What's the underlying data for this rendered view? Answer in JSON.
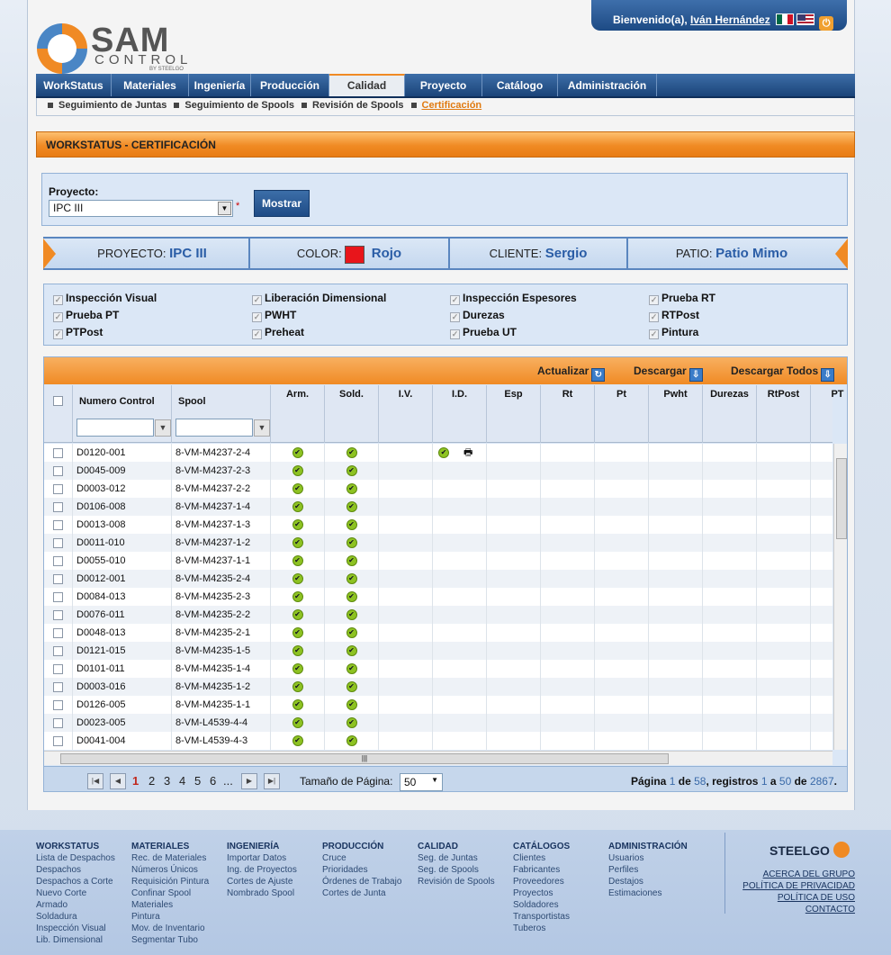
{
  "header": {
    "welcome_prefix": "Bienvenido(a),",
    "user_name": "Iván Hernández",
    "logo_main": "SAM",
    "logo_sub": "CONTROL",
    "logo_by": "BY STEELGO"
  },
  "nav": {
    "items": [
      "WorkStatus",
      "Materiales",
      "Ingeniería",
      "Producción",
      "Calidad",
      "Proyecto",
      "Catálogo",
      "Administración"
    ],
    "active": "Calidad"
  },
  "subnav": {
    "items": [
      "Seguimiento de Juntas",
      "Seguimiento de Spools",
      "Revisión de Spools",
      "Certificación"
    ],
    "current": "Certificación"
  },
  "page_title": "WORKSTATUS - CERTIFICACIÓN",
  "project_form": {
    "label": "Proyecto:",
    "selected": "IPC III",
    "required_mark": "*",
    "button": "Mostrar"
  },
  "info": {
    "proyecto_label": "PROYECTO:",
    "proyecto": "IPC III",
    "color_label": "COLOR:",
    "color_name": "Rojo",
    "color_hex": "#e8151b",
    "cliente_label": "CLIENTE:",
    "cliente": "Sergio",
    "patio_label": "PATIO:",
    "patio": "Patio Mimo"
  },
  "checkboxes": [
    [
      "Inspección Visual",
      "Liberación Dimensional",
      "Inspección Espesores",
      "Prueba RT"
    ],
    [
      "Prueba PT",
      "PWHT",
      "Durezas",
      "RTPost"
    ],
    [
      "PTPost",
      "Preheat",
      "Prueba UT",
      "Pintura"
    ]
  ],
  "grid_actions": {
    "refresh": "Actualizar",
    "download": "Descargar",
    "download_all": "Descargar Todos"
  },
  "columns": {
    "numero": "Numero Control",
    "spool": "Spool",
    "steps": [
      "Arm.",
      "Sold.",
      "I.V.",
      "I.D.",
      "Esp",
      "Rt",
      "Pt",
      "Pwht",
      "Durezas",
      "RtPost",
      "PT"
    ]
  },
  "rows": [
    [
      "D0120-001",
      "8-VM-M4237-2-4"
    ],
    [
      "D0045-009",
      "8-VM-M4237-2-3"
    ],
    [
      "D0003-012",
      "8-VM-M4237-2-2"
    ],
    [
      "D0106-008",
      "8-VM-M4237-1-4"
    ],
    [
      "D0013-008",
      "8-VM-M4237-1-3"
    ],
    [
      "D0011-010",
      "8-VM-M4237-1-2"
    ],
    [
      "D0055-010",
      "8-VM-M4237-1-1"
    ],
    [
      "D0012-001",
      "8-VM-M4235-2-4"
    ],
    [
      "D0084-013",
      "8-VM-M4235-2-3"
    ],
    [
      "D0076-011",
      "8-VM-M4235-2-2"
    ],
    [
      "D0048-013",
      "8-VM-M4235-2-1"
    ],
    [
      "D0121-015",
      "8-VM-M4235-1-5"
    ],
    [
      "D0101-011",
      "8-VM-M4235-1-4"
    ],
    [
      "D0003-016",
      "8-VM-M4235-1-2"
    ],
    [
      "D0126-005",
      "8-VM-M4235-1-1"
    ],
    [
      "D0023-005",
      "8-VM-L4539-4-4"
    ],
    [
      "D0041-004",
      "8-VM-L4539-4-3"
    ]
  ],
  "pager": {
    "pages": [
      "1",
      "2",
      "3",
      "4",
      "5",
      "6",
      "..."
    ],
    "current": "1",
    "size_label": "Tamaño de Página:",
    "size": "50",
    "summary_pagina": "Página",
    "page": "1",
    "de": "de",
    "total_pages": "58",
    "registros": ", registros",
    "from": "1",
    "a": "a",
    "to": "50",
    "de2": "de",
    "total": "2867",
    "dot": "."
  },
  "footer": {
    "cols": [
      {
        "h": "WORKSTATUS",
        "items": [
          "Lista de Despachos",
          "Despachos",
          "Despachos a Corte",
          "Nuevo Corte",
          "Armado",
          "Soldadura",
          "Inspección Visual",
          "Lib. Dimensional"
        ]
      },
      {
        "h": "MATERIALES",
        "items": [
          "Rec. de Materiales",
          "Números Únicos",
          "Requisición Pintura",
          "Confinar Spool",
          "Materiales",
          "Pintura",
          "Mov. de Inventario",
          "Segmentar Tubo"
        ]
      },
      {
        "h": "INGENIERÍA",
        "items": [
          "Importar Datos",
          "Ing. de Proyectos",
          "Cortes de Ajuste",
          "Nombrado Spool"
        ]
      },
      {
        "h": "PRODUCCIÓN",
        "items": [
          "Cruce",
          "Prioridades",
          "Órdenes de Trabajo",
          "Cortes de Junta"
        ]
      },
      {
        "h": "CALIDAD",
        "items": [
          "Seg. de Juntas",
          "Seg. de Spools",
          "Revisión de Spools"
        ]
      },
      {
        "h": "CATÁLOGOS",
        "items": [
          "Clientes",
          "Fabricantes",
          "Proveedores",
          "Proyectos",
          "Soldadores",
          "Transportistas",
          "Tuberos"
        ]
      },
      {
        "h": "ADMINISTRACIÓN",
        "items": [
          "Usuarios",
          "Perfiles",
          "Destajos",
          "Estimaciones"
        ]
      }
    ],
    "brand": "STEELGO",
    "links": [
      "ACERCA DEL GRUPO",
      "POLÍTICA DE PRIVACIDAD",
      "POLÍTICA DE USO",
      "CONTACTO"
    ]
  },
  "colors": {
    "accent": "#f08a24",
    "nav": "#1b4479",
    "panel": "#dbe7f6"
  },
  "icons": [
    "mexico-flag-icon",
    "usa-flag-icon",
    "power-icon",
    "refresh-icon",
    "download-icon",
    "download-all-icon",
    "filter-icon",
    "check-icon",
    "print-icon"
  ]
}
